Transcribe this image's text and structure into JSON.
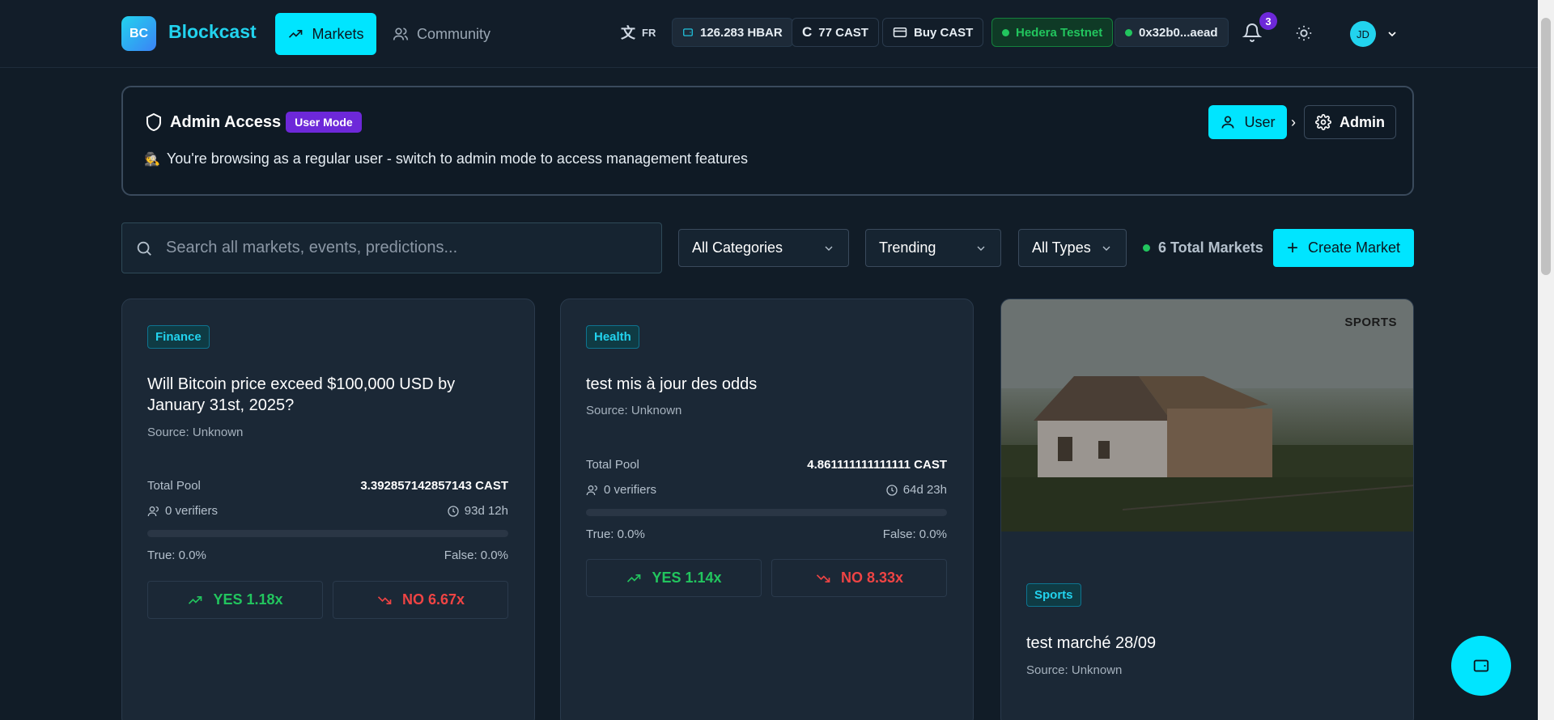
{
  "brand": {
    "logo_text": "BC",
    "name": "Blockcast"
  },
  "nav": {
    "markets": "Markets",
    "community": "Community"
  },
  "header": {
    "lang": "FR",
    "hbar_balance": "126.283 HBAR",
    "cast_balance": "77 CAST",
    "buy_label": "Buy CAST",
    "network": "Hedera Testnet",
    "wallet": "0x32b0...aead",
    "notifications": "3",
    "avatar_initials": "JD"
  },
  "admin_panel": {
    "title": "Admin Access",
    "mode_badge": "User Mode",
    "subtitle": "You're browsing as a regular user - switch to admin mode to access management features",
    "user_button": "User",
    "admin_button": "Admin"
  },
  "filters": {
    "search_placeholder": "Search all markets, events, predictions...",
    "category": "All Categories",
    "sort": "Trending",
    "type": "All Types",
    "total_markets": "6 Total Markets",
    "create_button": "Create Market"
  },
  "markets": [
    {
      "category": "Finance",
      "title": "Will Bitcoin price exceed $100,000 USD by January 31st, 2025?",
      "source": "Source: Unknown",
      "pool_label": "Total Pool",
      "pool_value": "3.392857142857143 CAST",
      "verifiers": "0 verifiers",
      "time_left": "93d 12h",
      "true_pct": "True: 0.0%",
      "false_pct": "False: 0.0%",
      "true_fraction": 0,
      "yes": "YES 1.18x",
      "no": "NO 6.67x"
    },
    {
      "category": "Health",
      "title": "test mis à jour des odds",
      "source": "Source: Unknown",
      "pool_label": "Total Pool",
      "pool_value": "4.861111111111111 CAST",
      "verifiers": "0 verifiers",
      "time_left": "64d 23h",
      "true_pct": "True: 0.0%",
      "false_pct": "False: 0.0%",
      "true_fraction": 0,
      "yes": "YES 1.14x",
      "no": "NO 8.33x"
    },
    {
      "image_label": "SPORTS",
      "category": "Sports",
      "title": "test marché 28/09",
      "source": "Source: Unknown"
    }
  ],
  "colors": {
    "accent": "#00e5ff",
    "yes": "#22c55e",
    "no": "#ef4444",
    "badge": "#6d28d9"
  }
}
